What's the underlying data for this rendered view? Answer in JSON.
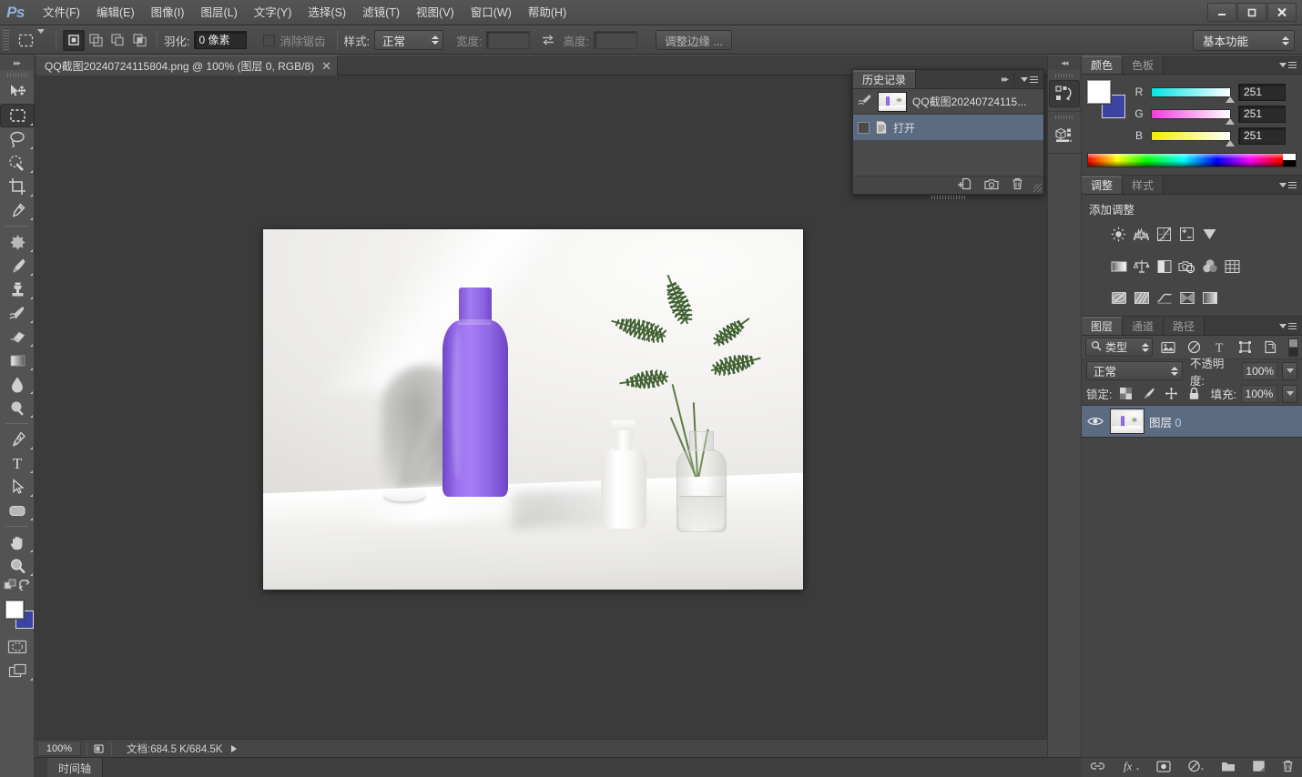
{
  "app": {
    "logo": "Ps",
    "menus": [
      {
        "label": "文件(F)"
      },
      {
        "label": "编辑(E)"
      },
      {
        "label": "图像(I)"
      },
      {
        "label": "图层(L)"
      },
      {
        "label": "文字(Y)"
      },
      {
        "label": "选择(S)"
      },
      {
        "label": "滤镜(T)"
      },
      {
        "label": "视图(V)"
      },
      {
        "label": "窗口(W)"
      },
      {
        "label": "帮助(H)"
      }
    ],
    "window_controls": {
      "minimize": "—",
      "maximize": "□",
      "close": "✕"
    }
  },
  "options_bar": {
    "tool_preset_name": "rectangular-marquee-tool",
    "selection_modes": [
      "new-selection",
      "add-to-selection",
      "subtract-from-selection",
      "intersect-with-selection"
    ],
    "feather_label": "羽化:",
    "feather_value": "0 像素",
    "antialias_label": "消除锯齿",
    "antialias_checked": false,
    "style_label": "样式:",
    "style_value": "正常",
    "width_label": "宽度:",
    "width_value": "",
    "height_label": "高度:",
    "height_value": "",
    "swap_icon": "swap-width-height-icon",
    "refine_edge_label": "调整边缘 ...",
    "workspace_value": "基本功能"
  },
  "toolbar": {
    "collapse_label": "▸▸",
    "tools": [
      {
        "name": "move-tool",
        "selected": false,
        "has_flyout": false
      },
      {
        "name": "rectangular-marquee-tool",
        "selected": true,
        "has_flyout": true
      },
      {
        "name": "lasso-tool",
        "selected": false,
        "has_flyout": true
      },
      {
        "name": "quick-selection-tool",
        "selected": false,
        "has_flyout": true
      },
      {
        "name": "crop-tool",
        "selected": false,
        "has_flyout": true
      },
      {
        "name": "eyedropper-tool",
        "selected": false,
        "has_flyout": true
      },
      {
        "name": "spot-healing-brush-tool",
        "selected": false,
        "has_flyout": true
      },
      {
        "name": "brush-tool",
        "selected": false,
        "has_flyout": true
      },
      {
        "name": "clone-stamp-tool",
        "selected": false,
        "has_flyout": true
      },
      {
        "name": "history-brush-tool",
        "selected": false,
        "has_flyout": true
      },
      {
        "name": "eraser-tool",
        "selected": false,
        "has_flyout": true
      },
      {
        "name": "gradient-tool",
        "selected": false,
        "has_flyout": true
      },
      {
        "name": "blur-tool",
        "selected": false,
        "has_flyout": true
      },
      {
        "name": "dodge-tool",
        "selected": false,
        "has_flyout": true
      },
      {
        "name": "pen-tool",
        "selected": false,
        "has_flyout": true
      },
      {
        "name": "horizontal-type-tool",
        "selected": false,
        "has_flyout": true
      },
      {
        "name": "path-selection-tool",
        "selected": false,
        "has_flyout": true
      },
      {
        "name": "rounded-rectangle-tool",
        "selected": false,
        "has_flyout": true
      },
      {
        "name": "hand-tool",
        "selected": false,
        "has_flyout": true
      },
      {
        "name": "zoom-tool",
        "selected": false,
        "has_flyout": true
      }
    ],
    "foreground_color": "#ffffff",
    "background_color": "#3b44a0",
    "quick_mask_icon": "edit-in-quick-mask-mode-icon",
    "screen_mode_icon": "change-screen-mode-icon",
    "default_colors_icon": "default-foreground-background-icon",
    "swap_colors_icon": "swap-foreground-background-icon"
  },
  "document": {
    "tab_title": "QQ截图20240724115804.png @ 100% (图层 0, RGB/8)",
    "close_glyph": "✕"
  },
  "canvas": {
    "image_alt": "product-photo-purple-bottle-palm-leaves"
  },
  "status_bar": {
    "zoom": "100%",
    "doc_info": "文档:684.5 K/684.5K",
    "arrow_glyph": "▶"
  },
  "timeline": {
    "tab_label": "时间轴"
  },
  "history_panel": {
    "tabs": [
      {
        "label": "历史记录",
        "active": true
      }
    ],
    "collapse_glyph": "▸▸",
    "menu_icon": "panel-menu-icon",
    "snapshot": {
      "label": "QQ截图20240724115...",
      "icon": "history-brush-source-icon"
    },
    "states": [
      {
        "label": "打开",
        "icon": "open-document-icon",
        "selected": true
      }
    ],
    "footer_buttons": [
      {
        "name": "create-document-from-state-icon"
      },
      {
        "name": "create-new-snapshot-icon"
      },
      {
        "name": "delete-state-icon"
      }
    ]
  },
  "icon_dock": {
    "collapse_glyph": "◂◂",
    "buttons": [
      {
        "name": "history-panel-icon",
        "active": true
      },
      {
        "name": "3d-panel-icon",
        "active": false
      }
    ]
  },
  "color_panel": {
    "tabs": [
      {
        "label": "颜色",
        "active": true
      },
      {
        "label": "色板",
        "active": false
      }
    ],
    "menu_icon": "panel-menu-icon",
    "foreground_color": "#ffffff",
    "background_color": "#3b44a0",
    "channels": [
      {
        "label": "R",
        "value": "251"
      },
      {
        "label": "G",
        "value": "251"
      },
      {
        "label": "B",
        "value": "251"
      }
    ]
  },
  "adjustments_panel": {
    "tabs": [
      {
        "label": "调整",
        "active": true
      },
      {
        "label": "样式",
        "active": false
      }
    ],
    "menu_icon": "panel-menu-icon",
    "heading": "添加调整",
    "rows": [
      [
        {
          "name": "brightness-contrast-icon"
        },
        {
          "name": "levels-icon"
        },
        {
          "name": "curves-icon"
        },
        {
          "name": "exposure-icon"
        },
        {
          "name": "vibrance-icon"
        }
      ],
      [
        {
          "name": "hue-saturation-icon"
        },
        {
          "name": "color-balance-icon"
        },
        {
          "name": "black-white-icon"
        },
        {
          "name": "photo-filter-icon"
        },
        {
          "name": "channel-mixer-icon"
        },
        {
          "name": "color-lookup-icon"
        }
      ],
      [
        {
          "name": "invert-icon"
        },
        {
          "name": "posterize-icon"
        },
        {
          "name": "threshold-icon"
        },
        {
          "name": "selective-color-icon"
        },
        {
          "name": "gradient-map-icon"
        }
      ]
    ]
  },
  "layers_panel": {
    "tabs": [
      {
        "label": "图层",
        "active": true
      },
      {
        "label": "通道",
        "active": false
      },
      {
        "label": "路径",
        "active": false
      }
    ],
    "menu_icon": "panel-menu-icon",
    "filter": {
      "search_icon": "search-icon",
      "kind_value": "类型",
      "filter_icons": [
        {
          "name": "filter-pixel-layers-icon"
        },
        {
          "name": "filter-adjustment-layers-icon"
        },
        {
          "name": "filter-type-layers-icon"
        },
        {
          "name": "filter-shape-layers-icon"
        },
        {
          "name": "filter-smart-objects-icon"
        }
      ],
      "toggle_icon": "filter-enable-toggle"
    },
    "blend_mode": "正常",
    "opacity_label": "不透明度:",
    "opacity_value": "100%",
    "lock_label": "锁定:",
    "lock_icons": [
      {
        "name": "lock-transparent-pixels-icon"
      },
      {
        "name": "lock-image-pixels-icon"
      },
      {
        "name": "lock-position-icon"
      },
      {
        "name": "lock-all-icon"
      }
    ],
    "fill_label": "填充:",
    "fill_value": "100%",
    "layers": [
      {
        "name": "图层",
        "number": "0",
        "visible": true,
        "selected": true,
        "eye_icon": "eye-icon",
        "thumb": "layer-thumbnail"
      }
    ],
    "footer_buttons": [
      {
        "name": "link-layers-icon"
      },
      {
        "name": "layer-style-fx-icon"
      },
      {
        "name": "add-layer-mask-icon"
      },
      {
        "name": "new-fill-adjustment-layer-icon"
      },
      {
        "name": "new-group-icon"
      },
      {
        "name": "new-layer-icon"
      },
      {
        "name": "delete-layer-icon"
      }
    ]
  },
  "colors": {
    "chrome_bg": "#535353",
    "panel_bg": "#454545",
    "canvas_bg": "#3b3b3b",
    "selection_blue": "#5b6b82",
    "accent_logo": "#8fb4d9",
    "bottle_purple": "#9a70ee"
  }
}
